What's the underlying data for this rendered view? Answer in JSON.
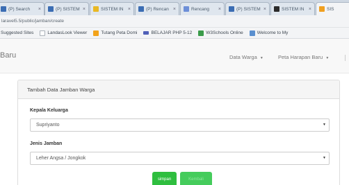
{
  "browser": {
    "tabs": [
      {
        "title": "(P) Search",
        "favicon_color": "#3b6db3"
      },
      {
        "title": "(P) SISTEM",
        "favicon_color": "#3b6db3"
      },
      {
        "title": "SISTEM IN",
        "favicon_color": "#e9b824"
      },
      {
        "title": "(P) Rencan",
        "favicon_color": "#3b6db3"
      },
      {
        "title": "Rencang",
        "favicon_color": "#6d8fd8"
      },
      {
        "title": "(P) SISTEM",
        "favicon_color": "#3b6db3"
      },
      {
        "title": "SISTEM IN",
        "favicon_color": "#2b2b2b"
      },
      {
        "title": "SIS",
        "favicon_color": "#f0a020"
      }
    ],
    "close_glyph": "×",
    "url": "laravel5.5/public/jamban/create",
    "bookmarks": [
      {
        "label": "Suggested Sites",
        "icon_color": "#4f7ccf"
      },
      {
        "label": "LandasLook Viewer",
        "icon_color": "#a9b0b8"
      },
      {
        "label": "Tutang Peta Domi",
        "icon_color": "#f2a31b"
      },
      {
        "label": "BELAJAR PHP 5-12",
        "icon_color": "#5060b8"
      },
      {
        "label": "W3Schools Online",
        "icon_color": "#3a9b4a"
      },
      {
        "label": "Welcome to My",
        "icon_color": "#5a8fcf"
      }
    ]
  },
  "navbar": {
    "brand": "Baru",
    "menu": [
      {
        "label": "Data Warga"
      },
      {
        "label": "Peta Harapan Baru"
      }
    ],
    "caret": "▼"
  },
  "form": {
    "heading": "Tambah Data Jamban Warga",
    "fields": [
      {
        "label": "Kepala Keluarga",
        "value": "Supriyanto"
      },
      {
        "label": "Jenis Jamban",
        "value": "Leher Angsa / Jongkok"
      }
    ],
    "select_arrow": "▼",
    "buttons": {
      "primary": "simpan",
      "secondary": "Kembali"
    }
  },
  "colors": {
    "success": "#2fbe3f"
  }
}
